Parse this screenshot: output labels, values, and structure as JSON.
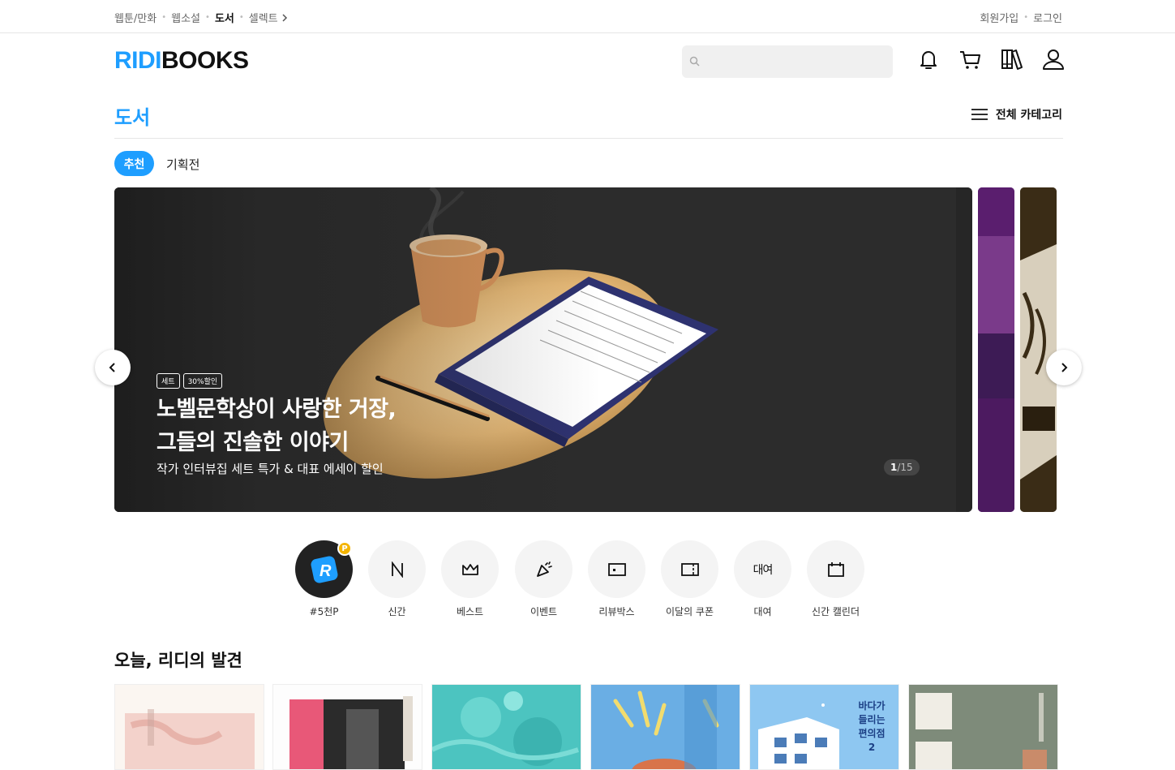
{
  "gnb": {
    "left": [
      "웹툰/만화",
      "웹소설",
      "도서",
      "셀렉트"
    ],
    "right": [
      "회원가입",
      "로그인"
    ]
  },
  "header": {
    "logo_ridi": "RIDI",
    "logo_books": "BOOKS",
    "search_placeholder": ""
  },
  "section": {
    "title": "도서",
    "all_category": "전체 카테고리",
    "tabs": [
      "추천",
      "기획전"
    ]
  },
  "banner": {
    "badges": [
      "세트",
      "30%할인"
    ],
    "title_line1": "노벨문학상이 사랑한 거장,",
    "title_line2": "그들의 진솔한 이야기",
    "subtitle": "작가 인터뷰집 세트 특가 & 대표 에세이 할인",
    "counter_current": "1",
    "counter_total": "/15"
  },
  "quick_menu": [
    {
      "label": "#5천P",
      "icon": "ridi-point-icon"
    },
    {
      "label": "신간",
      "icon": "new-icon"
    },
    {
      "label": "베스트",
      "icon": "crown-icon"
    },
    {
      "label": "이벤트",
      "icon": "party-icon"
    },
    {
      "label": "리뷰박스",
      "icon": "review-box-icon"
    },
    {
      "label": "이달의 쿠폰",
      "icon": "coupon-icon"
    },
    {
      "label": "대여",
      "icon": "rental-icon"
    },
    {
      "label": "신간 캘린더",
      "icon": "calendar-icon"
    }
  ],
  "quick_menu_badge": "P",
  "rental_icon_text": "대여",
  "discovery": {
    "title": "오늘, 리디의 발견",
    "book3_text": "바다가 들리는 편의점 2"
  },
  "colors": {
    "brand": "#1e9eff",
    "point_badge": "#f4b400"
  }
}
